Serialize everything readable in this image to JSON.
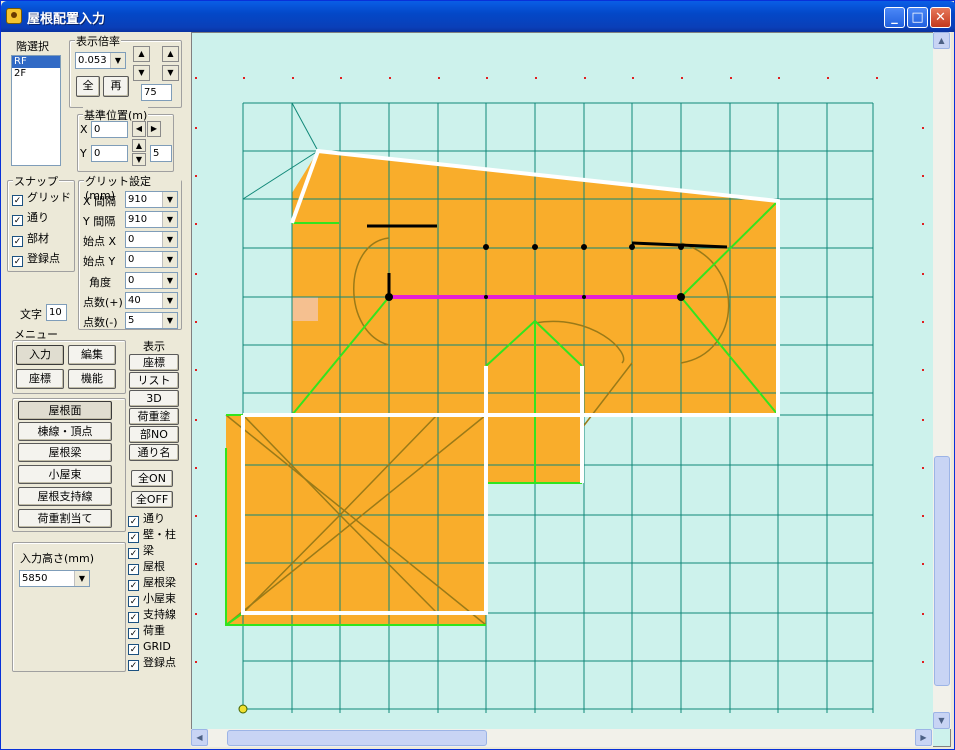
{
  "window": {
    "title": "屋根配置入力"
  },
  "floor": {
    "label": "階選択",
    "items": [
      "RF",
      "2F"
    ],
    "selected": 0
  },
  "zoom": {
    "label": "表示倍率",
    "value": "0.053",
    "all_label": "全",
    "redraw_label": "再",
    "step": "75"
  },
  "base": {
    "label": "基準位置(m)",
    "x_label": "X",
    "x_value": "0",
    "y_label": "Y",
    "y_value": "0",
    "step": "5"
  },
  "snap": {
    "label": "スナップ",
    "items": [
      {
        "label": "グリッド",
        "checked": true
      },
      {
        "label": "通り",
        "checked": true
      },
      {
        "label": "部材",
        "checked": true
      },
      {
        "label": "登録点",
        "checked": true
      }
    ]
  },
  "grid": {
    "label": "グリット設定 (mm)",
    "rows": [
      {
        "label": "X 間隔",
        "value": "910"
      },
      {
        "label": "Y 間隔",
        "value": "910"
      },
      {
        "label": "始点 X",
        "value": "0"
      },
      {
        "label": "始点 Y",
        "value": "0"
      },
      {
        "label": "角度",
        "value": "0"
      },
      {
        "label": "点数(+)",
        "value": "40"
      },
      {
        "label": "点数(-)",
        "value": "5"
      }
    ]
  },
  "text_size": {
    "label": "文字",
    "value": "10"
  },
  "menu": {
    "label": "メニュー",
    "input": "入力",
    "edit": "編集",
    "coords": "座標",
    "function": "機能"
  },
  "tools": [
    "屋根面",
    "棟線・頂点",
    "屋根梁",
    "小屋束",
    "屋根支持線",
    "荷重割当て"
  ],
  "display": {
    "label": "表示",
    "buttons": [
      "座標",
      "リスト",
      "3D",
      "荷重塗",
      "部NO",
      "通り名"
    ],
    "all_on": "全ON",
    "all_off": "全OFF",
    "checks": [
      {
        "label": "通り",
        "checked": true
      },
      {
        "label": "壁・柱",
        "checked": true
      },
      {
        "label": "梁",
        "checked": true
      },
      {
        "label": "屋根",
        "checked": true
      },
      {
        "label": "屋根梁",
        "checked": true
      },
      {
        "label": "小屋束",
        "checked": true
      },
      {
        "label": "支持線",
        "checked": true
      },
      {
        "label": "荷重",
        "checked": true
      },
      {
        "label": "GRID",
        "checked": true
      },
      {
        "label": "登録点",
        "checked": true
      }
    ]
  },
  "height": {
    "label": "入力高さ(mm)",
    "value": "5850"
  },
  "colors": {
    "canvas": "#cdf2ec",
    "roof": "#f9ad2b",
    "grid": "#108878",
    "ridge": "#33e41e",
    "valley": "#9a7a18",
    "selected": "#e61fd6"
  }
}
